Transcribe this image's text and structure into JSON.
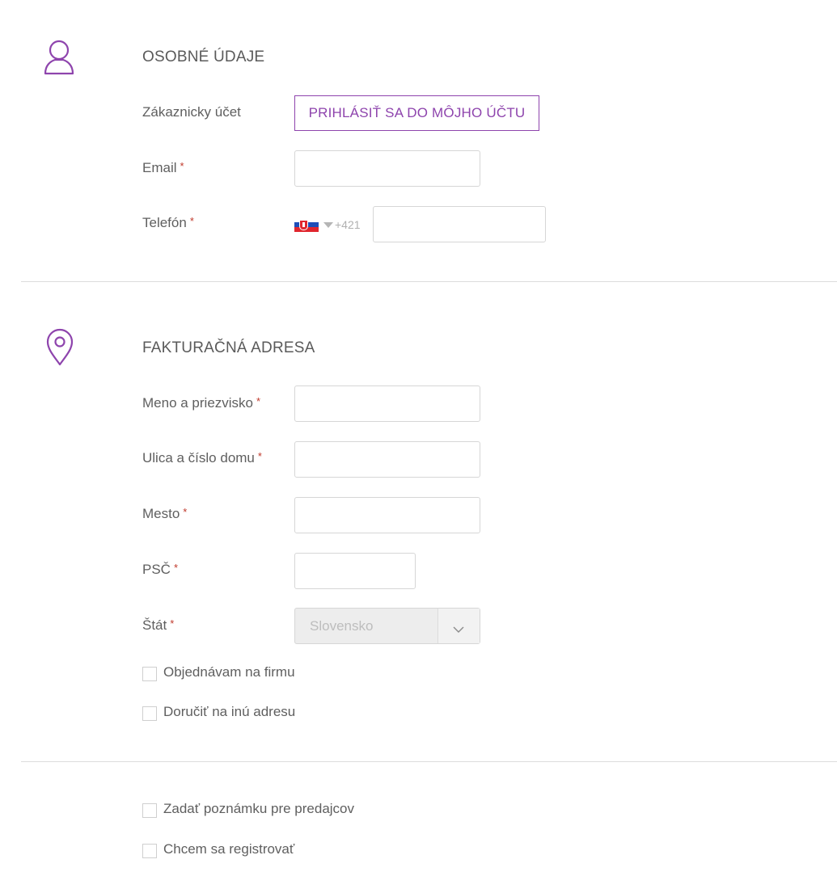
{
  "personal": {
    "title": "OSOBNÉ ÚDAJE",
    "account_label": "Zákaznicky účet",
    "login_button": "PRIHLÁSIŤ SA DO MÔJHO ÚČTU",
    "email_label": "Email",
    "phone_label": "Telefón",
    "phone_prefix": "+421",
    "required_mark": "*"
  },
  "billing": {
    "title": "FAKTURAČNÁ ADRESA",
    "name_label": "Meno a priezvisko",
    "street_label": "Ulica a číslo domu",
    "city_label": "Mesto",
    "zip_label": "PSČ",
    "country_label": "Štát",
    "country_value": "Slovensko",
    "company_checkbox": "Objednávam na firmu",
    "other_address_checkbox": "Doručiť na inú adresu"
  },
  "extras": {
    "note_checkbox": "Zadať poznámku pre predajcov",
    "register_checkbox": "Chcem sa registrovať"
  },
  "colors": {
    "accent": "#8e44ad",
    "required": "#c0392b"
  },
  "icons": {
    "personal": "user-icon",
    "billing": "map-pin-icon",
    "flag": "slovakia-flag-icon",
    "caret": "caret-down-icon",
    "select": "chevron-down-icon"
  }
}
